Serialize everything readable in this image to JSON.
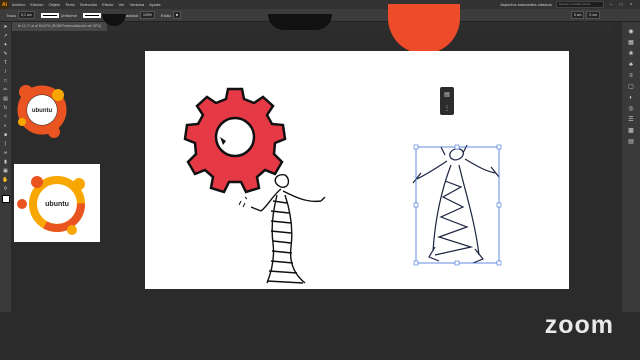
{
  "menubar": {
    "app_logo": "Ai",
    "menus": [
      "Archivo",
      "Edición",
      "Objeto",
      "Texto",
      "Selección",
      "Efecto",
      "Ver",
      "Ventana",
      "Ayuda"
    ],
    "workspace": "Aspectos esenciales clásicos",
    "search_placeholder": "Buscar en Adobe Stock"
  },
  "controlbar": {
    "mode": "Trazo",
    "stroke_weight": "0,1 cm",
    "brush": "Uniforme",
    "profile": "Básico",
    "opacity_label": "Opacidad",
    "opacity_value": "100%",
    "style_label": "Estilo",
    "x_value": "0 cm",
    "y_value": "0 cm"
  },
  "document_tab": {
    "label": "fe 11 ?? ai al 66,67% (RGB/Previsualización de GPU)"
  },
  "watermark": {
    "text": "zoom"
  },
  "colors": {
    "gear_red": "#e63946",
    "ubuntu_orange": "#e95420",
    "ubuntu_yellow": "#f7a700",
    "accent_red": "#ee4b2b"
  },
  "logos": {
    "ubuntu_left_text": "ubuntu",
    "ubuntu_card_text": "ubuntu"
  },
  "icons": {
    "left_tools": [
      "selection-tool-icon",
      "direct-selection-tool-icon",
      "magic-wand-icon",
      "lasso-icon",
      "pen-tool-icon",
      "type-tool-icon",
      "line-tool-icon",
      "rectangle-tool-icon",
      "paintbrush-icon",
      "pencil-icon",
      "eraser-icon",
      "rotate-icon",
      "scale-icon",
      "width-tool-icon",
      "free-transform-icon",
      "shape-builder-icon",
      "perspective-icon",
      "mesh-icon",
      "gradient-icon",
      "eyedropper-icon",
      "blend-icon",
      "symbol-sprayer-icon",
      "graph-icon",
      "artboard-icon",
      "slice-icon",
      "hand-icon",
      "zoom-icon"
    ],
    "right_panels": [
      "color-panel-icon",
      "swatches-panel-icon",
      "brushes-panel-icon",
      "symbols-panel-icon",
      "stroke-panel-icon",
      "gradient-panel-icon",
      "transparency-panel-icon",
      "appearance-panel-icon",
      "graphic-styles-panel-icon",
      "layers-panel-icon",
      "artboards-panel-icon",
      "align-panel-icon"
    ]
  }
}
